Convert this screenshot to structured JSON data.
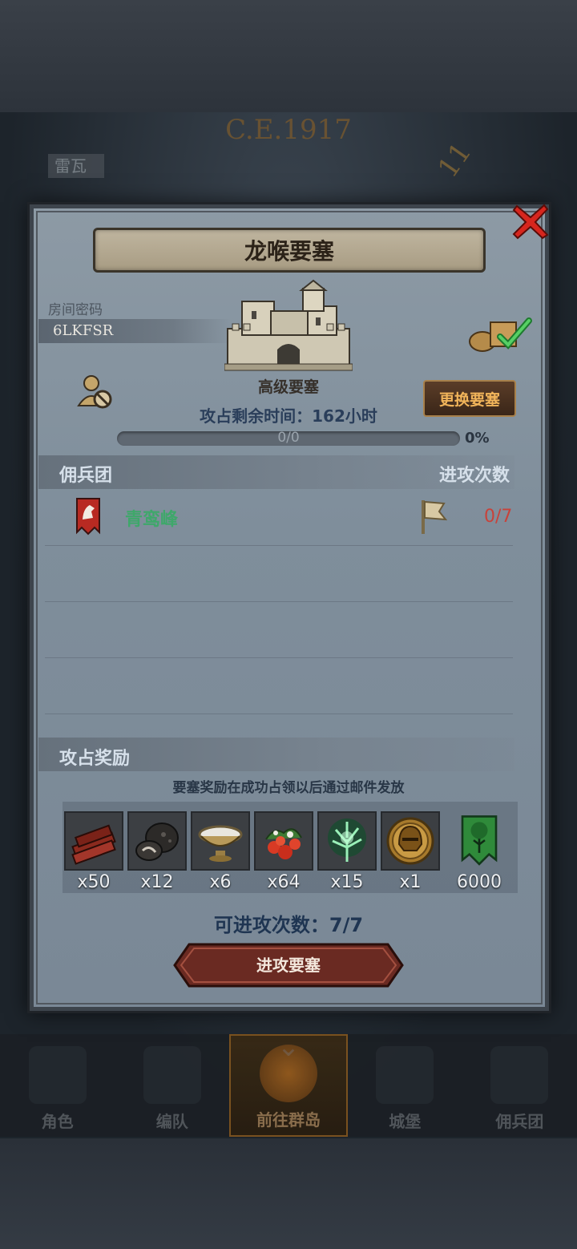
{
  "background": {
    "era": "C.E.1917",
    "tag": "雷瓦",
    "clock_number": "11"
  },
  "modal": {
    "title": "龙喉要塞",
    "room_code_label": "房间密码",
    "room_code": "6LKFSR",
    "fortress_type": "高级要塞",
    "change_button": "更换要塞",
    "remaining_time": "攻占剩余时间：162小时",
    "progress": {
      "text": "0/0",
      "percent_label": "0%",
      "value": 0
    },
    "guild_section": {
      "title": "佣兵团",
      "attack_header": "进攻次数"
    },
    "guilds": [
      {
        "name": "青鸾峰",
        "attacks": "0/7",
        "icon": "wolf-banner-icon"
      }
    ],
    "rewards_section": {
      "title": "攻占奖励",
      "note": "要塞奖励在成功占领以后通过邮件发放",
      "items": [
        {
          "icon": "wood-planks-icon",
          "qty": "x50"
        },
        {
          "icon": "truffle-icon",
          "qty": "x12"
        },
        {
          "icon": "milk-bowl-icon",
          "qty": "x6"
        },
        {
          "icon": "berries-icon",
          "qty": "x64"
        },
        {
          "icon": "spirit-tree-icon",
          "qty": "x15"
        },
        {
          "icon": "golden-helmet-icon",
          "qty": "x1"
        },
        {
          "icon": "tree-banner-icon",
          "qty": "6000"
        }
      ]
    },
    "attacks_available": "可进攻次数：7/7",
    "attack_button": "进攻要塞"
  },
  "bottom_nav": [
    {
      "label": "角色",
      "icon": "knight-icon"
    },
    {
      "label": "编队",
      "icon": "formation-icon"
    },
    {
      "label": "前往群岛",
      "icon": "islands-icon",
      "active": true
    },
    {
      "label": "城堡",
      "icon": "castle-icon"
    },
    {
      "label": "佣兵团",
      "icon": "mercenary-icon"
    }
  ],
  "colors": {
    "guild_name": "#3ea86a",
    "attack_count": "#c8423a",
    "change_button_text": "#f1b45a",
    "close": "#d6261e"
  }
}
